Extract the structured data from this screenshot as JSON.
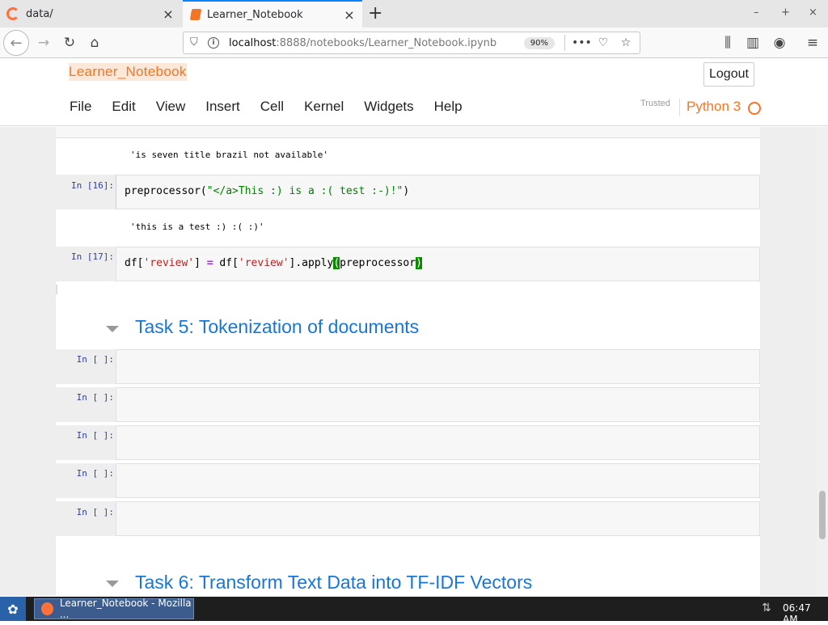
{
  "browser": {
    "tabs": [
      {
        "title": "data/",
        "active": false
      },
      {
        "title": "Learner_Notebook",
        "active": true
      }
    ],
    "new_tab": "+",
    "window_controls": [
      "–",
      "+",
      "×"
    ],
    "url_host": "localhost",
    "url_rest": ":8888/notebooks/Learner_Notebook.ipynb",
    "zoom": "90%",
    "accent_color": "#0a84ff"
  },
  "jupyter": {
    "notebook_name": "Learner_Notebook",
    "logout_label": "Logout",
    "menu": [
      "File",
      "Edit",
      "View",
      "Insert",
      "Cell",
      "Kernel",
      "Widgets",
      "Help"
    ],
    "trusted_label": "Trusted",
    "kernel_name": "Python 3",
    "brand_color": "#f37626"
  },
  "cells": {
    "out_15": "'is seven title brazil not available'",
    "c16": {
      "prompt": "In [16]:",
      "fn": "preprocessor",
      "arg": "\"</a>This :) is a :( test :-)!\""
    },
    "out_16": "'this is a test :) :( :)'",
    "c17": {
      "prompt": "In [17]:",
      "left": "df[",
      "key1": "'review'",
      "mid": "] ",
      "op": "=",
      "right1": " df[",
      "key2": "'review'",
      "right2": "].apply",
      "open": "(",
      "arg": "preprocessor",
      "close": ")"
    },
    "task5_heading": "Task 5: Tokenization of documents",
    "empty_prompts": [
      "In [ ]:",
      "In [ ]:",
      "In [ ]:",
      "In [ ]:",
      "In [ ]:"
    ],
    "task6_heading": "Task 6: Transform Text Data into TF-IDF Vectors"
  },
  "taskbar": {
    "window_title": "Learner_Notebook - Mozilla ...",
    "clock": "06:47 AM"
  }
}
